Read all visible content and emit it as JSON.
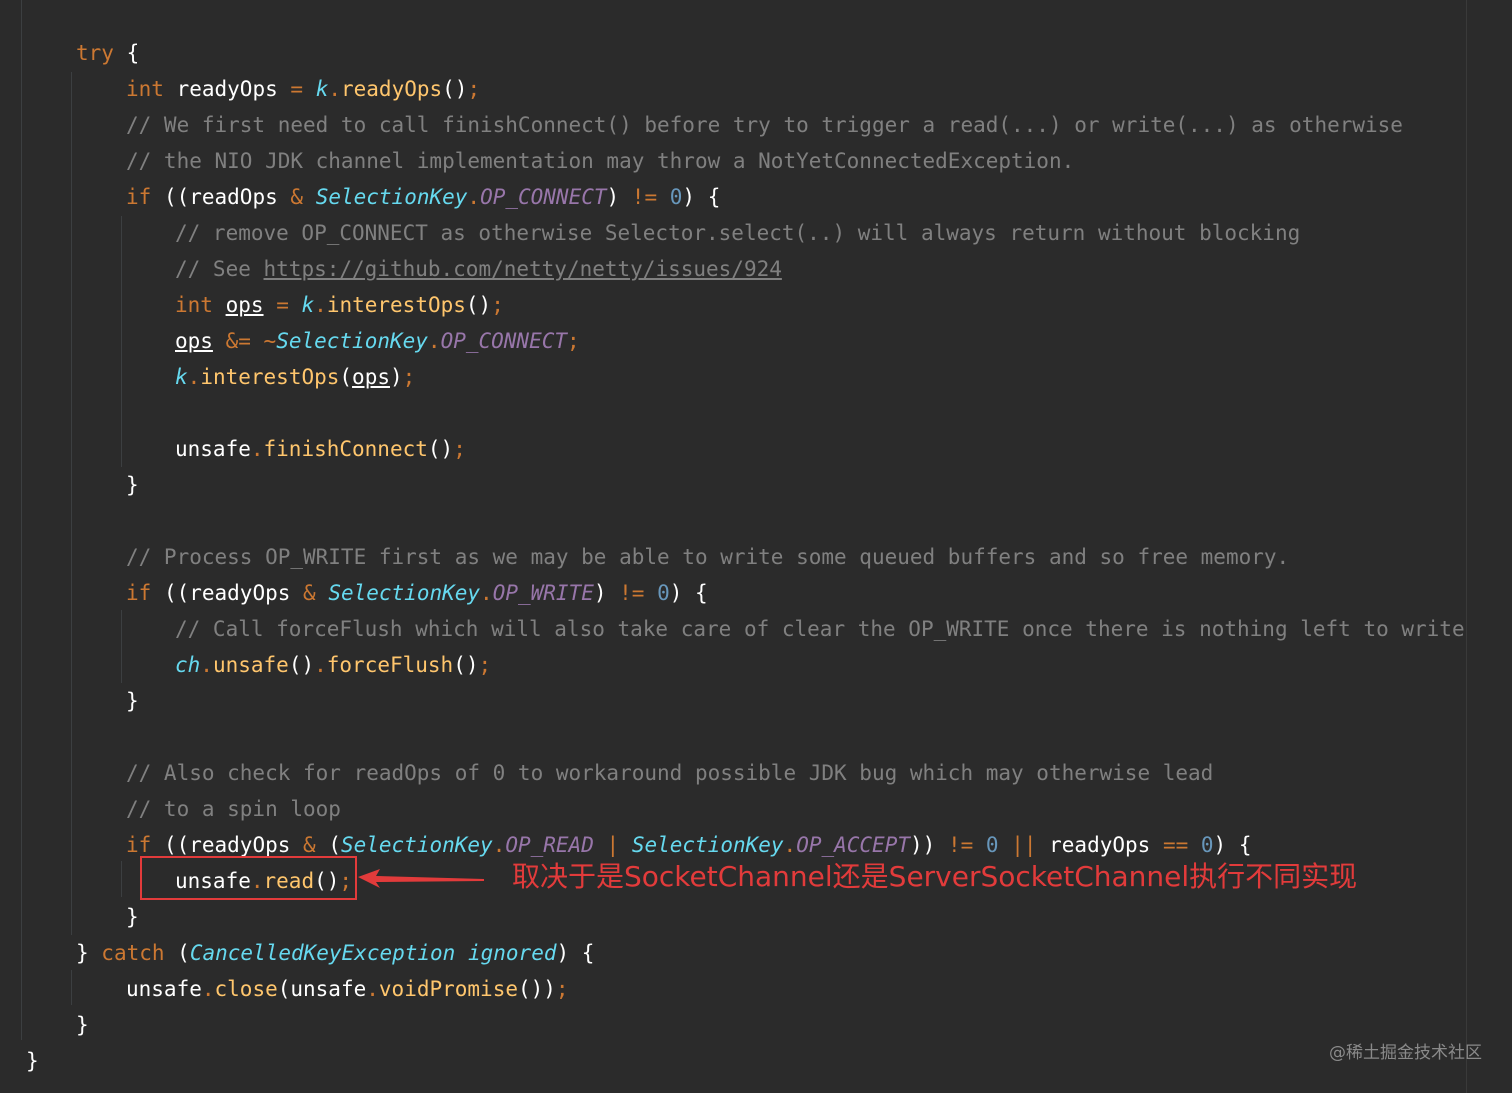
{
  "code_lines": [
    [
      {
        "t": "try",
        "c": "kw"
      },
      {
        "t": " {",
        "c": "plain"
      }
    ],
    [
      {
        "t": "int",
        "c": "kw"
      },
      {
        "t": " readyOps ",
        "c": "plain"
      },
      {
        "t": "=",
        "c": "op"
      },
      {
        "t": " ",
        "c": "plain"
      },
      {
        "t": "k",
        "c": "var"
      },
      {
        "t": ".",
        "c": "semi"
      },
      {
        "t": "readyOps",
        "c": "fn"
      },
      {
        "t": "()",
        "c": "plain"
      },
      {
        "t": ";",
        "c": "semi"
      }
    ],
    [
      {
        "t": "// We first need to call finishConnect() before try to trigger a read(...) or write(...) as otherwise",
        "c": "cm"
      }
    ],
    [
      {
        "t": "// the NIO JDK channel implementation may throw a NotYetConnectedException.",
        "c": "cm"
      }
    ],
    [
      {
        "t": "if",
        "c": "kw"
      },
      {
        "t": " ((readOps ",
        "c": "plain"
      },
      {
        "t": "&",
        "c": "op"
      },
      {
        "t": " ",
        "c": "plain"
      },
      {
        "t": "SelectionKey",
        "c": "type"
      },
      {
        "t": ".",
        "c": "semi"
      },
      {
        "t": "OP_CONNECT",
        "c": "field"
      },
      {
        "t": ") ",
        "c": "plain"
      },
      {
        "t": "!=",
        "c": "op"
      },
      {
        "t": " ",
        "c": "plain"
      },
      {
        "t": "0",
        "c": "num"
      },
      {
        "t": ") {",
        "c": "plain"
      }
    ],
    [
      {
        "t": "// remove OP_CONNECT as otherwise Selector.select(..) will always return without blocking",
        "c": "cm"
      }
    ],
    [
      {
        "t": "// See ",
        "c": "cm"
      },
      {
        "t": "https://github.com/netty/netty/issues/924",
        "c": "link"
      }
    ],
    [
      {
        "t": "int",
        "c": "kw"
      },
      {
        "t": " ",
        "c": "plain"
      },
      {
        "t": "ops",
        "c": "ul"
      },
      {
        "t": " ",
        "c": "plain"
      },
      {
        "t": "=",
        "c": "op"
      },
      {
        "t": " ",
        "c": "plain"
      },
      {
        "t": "k",
        "c": "var"
      },
      {
        "t": ".",
        "c": "semi"
      },
      {
        "t": "interestOps",
        "c": "fn"
      },
      {
        "t": "()",
        "c": "plain"
      },
      {
        "t": ";",
        "c": "semi"
      }
    ],
    [
      {
        "t": "ops",
        "c": "ul"
      },
      {
        "t": " ",
        "c": "plain"
      },
      {
        "t": "&=",
        "c": "op"
      },
      {
        "t": " ",
        "c": "plain"
      },
      {
        "t": "~",
        "c": "op"
      },
      {
        "t": "SelectionKey",
        "c": "type"
      },
      {
        "t": ".",
        "c": "semi"
      },
      {
        "t": "OP_CONNECT",
        "c": "field"
      },
      {
        "t": ";",
        "c": "semi"
      }
    ],
    [
      {
        "t": "k",
        "c": "var"
      },
      {
        "t": ".",
        "c": "semi"
      },
      {
        "t": "interestOps",
        "c": "fn"
      },
      {
        "t": "(",
        "c": "plain"
      },
      {
        "t": "ops",
        "c": "ul"
      },
      {
        "t": ")",
        "c": "plain"
      },
      {
        "t": ";",
        "c": "semi"
      }
    ],
    [],
    [
      {
        "t": "unsafe",
        "c": "plain"
      },
      {
        "t": ".",
        "c": "semi"
      },
      {
        "t": "finishConnect",
        "c": "fn"
      },
      {
        "t": "()",
        "c": "plain"
      },
      {
        "t": ";",
        "c": "semi"
      }
    ],
    [
      {
        "t": "}",
        "c": "plain"
      }
    ],
    [],
    [
      {
        "t": "// Process OP_WRITE first as we may be able to write some queued buffers and so free memory.",
        "c": "cm"
      }
    ],
    [
      {
        "t": "if",
        "c": "kw"
      },
      {
        "t": " ((readyOps ",
        "c": "plain"
      },
      {
        "t": "&",
        "c": "op"
      },
      {
        "t": " ",
        "c": "plain"
      },
      {
        "t": "SelectionKey",
        "c": "type"
      },
      {
        "t": ".",
        "c": "semi"
      },
      {
        "t": "OP_WRITE",
        "c": "field"
      },
      {
        "t": ") ",
        "c": "plain"
      },
      {
        "t": "!=",
        "c": "op"
      },
      {
        "t": " ",
        "c": "plain"
      },
      {
        "t": "0",
        "c": "num"
      },
      {
        "t": ") {",
        "c": "plain"
      }
    ],
    [
      {
        "t": "// Call forceFlush which will also take care of clear the OP_WRITE once there is nothing left to write",
        "c": "cm"
      }
    ],
    [
      {
        "t": "ch",
        "c": "var"
      },
      {
        "t": ".",
        "c": "semi"
      },
      {
        "t": "unsafe",
        "c": "fn"
      },
      {
        "t": "()",
        "c": "plain"
      },
      {
        "t": ".",
        "c": "semi"
      },
      {
        "t": "forceFlush",
        "c": "fn"
      },
      {
        "t": "()",
        "c": "plain"
      },
      {
        "t": ";",
        "c": "semi"
      }
    ],
    [
      {
        "t": "}",
        "c": "plain"
      }
    ],
    [],
    [
      {
        "t": "// Also check for readOps of 0 to workaround possible JDK bug which may otherwise lead",
        "c": "cm"
      }
    ],
    [
      {
        "t": "// to a spin loop",
        "c": "cm"
      }
    ],
    [
      {
        "t": "if",
        "c": "kw"
      },
      {
        "t": " ((readyOps ",
        "c": "plain"
      },
      {
        "t": "&",
        "c": "op"
      },
      {
        "t": " (",
        "c": "plain"
      },
      {
        "t": "SelectionKey",
        "c": "type"
      },
      {
        "t": ".",
        "c": "semi"
      },
      {
        "t": "OP_READ",
        "c": "field"
      },
      {
        "t": " ",
        "c": "plain"
      },
      {
        "t": "|",
        "c": "op"
      },
      {
        "t": " ",
        "c": "plain"
      },
      {
        "t": "SelectionKey",
        "c": "type"
      },
      {
        "t": ".",
        "c": "semi"
      },
      {
        "t": "OP_ACCEPT",
        "c": "field"
      },
      {
        "t": ")) ",
        "c": "plain"
      },
      {
        "t": "!=",
        "c": "op"
      },
      {
        "t": " ",
        "c": "plain"
      },
      {
        "t": "0",
        "c": "num"
      },
      {
        "t": " ",
        "c": "plain"
      },
      {
        "t": "||",
        "c": "op"
      },
      {
        "t": " readyOps ",
        "c": "plain"
      },
      {
        "t": "==",
        "c": "op"
      },
      {
        "t": " ",
        "c": "plain"
      },
      {
        "t": "0",
        "c": "num"
      },
      {
        "t": ") {",
        "c": "plain"
      }
    ],
    [
      {
        "t": "unsafe",
        "c": "plain"
      },
      {
        "t": ".",
        "c": "semi"
      },
      {
        "t": "read",
        "c": "fn"
      },
      {
        "t": "()",
        "c": "plain"
      },
      {
        "t": ";",
        "c": "semi"
      }
    ],
    [
      {
        "t": "}",
        "c": "plain"
      }
    ],
    [
      {
        "t": "} ",
        "c": "plain"
      },
      {
        "t": "catch",
        "c": "kw"
      },
      {
        "t": " (",
        "c": "plain"
      },
      {
        "t": "CancelledKeyException",
        "c": "type"
      },
      {
        "t": " ",
        "c": "plain"
      },
      {
        "t": "ignored",
        "c": "type"
      },
      {
        "t": ") {",
        "c": "plain"
      }
    ],
    [
      {
        "t": "unsafe",
        "c": "plain"
      },
      {
        "t": ".",
        "c": "semi"
      },
      {
        "t": "close",
        "c": "fn"
      },
      {
        "t": "(unsafe",
        "c": "plain"
      },
      {
        "t": ".",
        "c": "semi"
      },
      {
        "t": "voidPromise",
        "c": "fn"
      },
      {
        "t": "())",
        "c": "plain"
      },
      {
        "t": ";",
        "c": "semi"
      }
    ],
    [
      {
        "t": "}",
        "c": "plain"
      }
    ],
    [
      {
        "t": "}",
        "c": "plain"
      }
    ]
  ],
  "annotation": {
    "text": "取决于是SocketChannel还是ServerSocketChannel执行不同实现",
    "color": "#e23b3b"
  },
  "watermark": "@稀土掘金技术社区",
  "theme": {
    "background": "#2b2b2b",
    "keyword": "#cc7832",
    "comment": "#808080",
    "function": "#ffc66d",
    "field": "#9876aa",
    "type": "#66d9ef",
    "number": "#6897bb"
  }
}
